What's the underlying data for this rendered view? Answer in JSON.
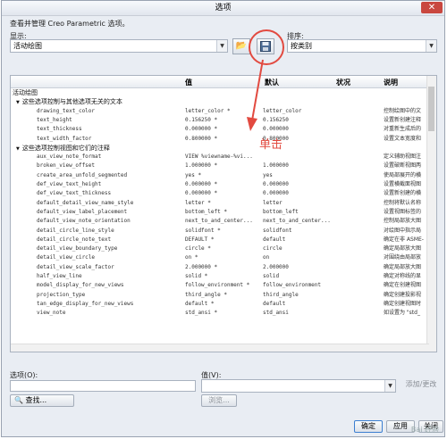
{
  "window": {
    "title": "选项",
    "close_label": "✕"
  },
  "subtitle": "查看并管理 Creo Parametric 选项。",
  "show": {
    "label": "显示:",
    "value": "活动绘图"
  },
  "sort": {
    "label": "排序:",
    "value": "按类别"
  },
  "grid": {
    "headers": {
      "name": "",
      "value": "值",
      "default": "默认",
      "status": "状况",
      "desc": "说明"
    },
    "rows": [
      {
        "type": "cat",
        "name": "活动绘图"
      },
      {
        "type": "cat",
        "name": "这些选项控制与其他选项无关的文本",
        "indent": 1
      },
      {
        "name": "drawing_text_color",
        "value": "letter_color *",
        "default": "letter_color",
        "desc": "控制绘图中的文"
      },
      {
        "name": "text_height",
        "value": "0.156250 *",
        "default": "0.156250",
        "desc": "设置新创建注释"
      },
      {
        "name": "text_thickness",
        "value": "0.000000 *",
        "default": "0.000000",
        "desc": "对重新生成后的"
      },
      {
        "name": "text_width_factor",
        "value": "0.800000 *",
        "default": "0.800000",
        "desc": "设置文本宽度和"
      },
      {
        "type": "cat",
        "name": "这些选项控制视图和它们的注释",
        "indent": 1
      },
      {
        "name": "aux_view_note_format",
        "value": "VIEW %viewname-%vi...",
        "default": "",
        "desc": "定义辅助视图注"
      },
      {
        "name": "broken_view_offset",
        "value": "1.000000 *",
        "default": "1.000000",
        "desc": "设置破断视图两"
      },
      {
        "name": "create_area_unfold_segmented",
        "value": "yes *",
        "default": "yes",
        "desc": "使局部展开的横"
      },
      {
        "name": "def_view_text_height",
        "value": "0.000000 *",
        "default": "0.000000",
        "desc": "设置横截面视图"
      },
      {
        "name": "def_view_text_thickness",
        "value": "0.000000 *",
        "default": "0.000000",
        "desc": "设置新创建的横"
      },
      {
        "name": "default_detail_view_name_style",
        "value": "letter *",
        "default": "letter",
        "desc": "控制将默认名称"
      },
      {
        "name": "default_view_label_placement",
        "value": "bottom_left *",
        "default": "bottom_left",
        "desc": "设置视图标签的"
      },
      {
        "name": "default_view_note_orientation",
        "value": "next_to_and_center...",
        "default": "next_to_and_center...",
        "desc": "控制局部放大图"
      },
      {
        "name": "detail_circle_line_style",
        "value": "solidfont *",
        "default": "solidfont",
        "desc": "对绘图中指示局"
      },
      {
        "name": "detail_circle_note_text",
        "value": "DEFAULT *",
        "default": "default",
        "desc": "确定在非 ASME-"
      },
      {
        "name": "detail_view_boundary_type",
        "value": "circle *",
        "default": "circle",
        "desc": "确定局部放大图"
      },
      {
        "name": "detail_view_circle",
        "value": "on *",
        "default": "on",
        "desc": "对围绕由局部放"
      },
      {
        "name": "detail_view_scale_factor",
        "value": "2.000000 *",
        "default": "2.000000",
        "desc": "确定局部放大图"
      },
      {
        "name": "half_view_line",
        "value": "solid *",
        "default": "solid",
        "desc": "确定对称线的显"
      },
      {
        "name": "model_display_for_new_views",
        "value": "follow_environment *",
        "default": "follow_environment",
        "desc": "确定在创建视图"
      },
      {
        "name": "projection_type",
        "value": "third_angle *",
        "default": "third_angle",
        "desc": "确定创建投影视"
      },
      {
        "name": "tan_edge_display_for_new_views",
        "value": "default *",
        "default": "default",
        "desc": "确定创建视图时"
      },
      {
        "name": "view_note",
        "value": "std_ansi *",
        "default": "std_ansi",
        "desc": "如设置为 \"std_"
      }
    ]
  },
  "option": {
    "label": "选项(O):",
    "value": ""
  },
  "optvalue": {
    "label": "值(V):",
    "value": ""
  },
  "buttons": {
    "add_change": "添加/更改",
    "find": "查找...",
    "browse": "浏览...",
    "ok": "确定",
    "apply": "应用",
    "close": "关闭"
  },
  "annotation": {
    "text": "单击"
  },
  "watermark": "Bai 经验"
}
